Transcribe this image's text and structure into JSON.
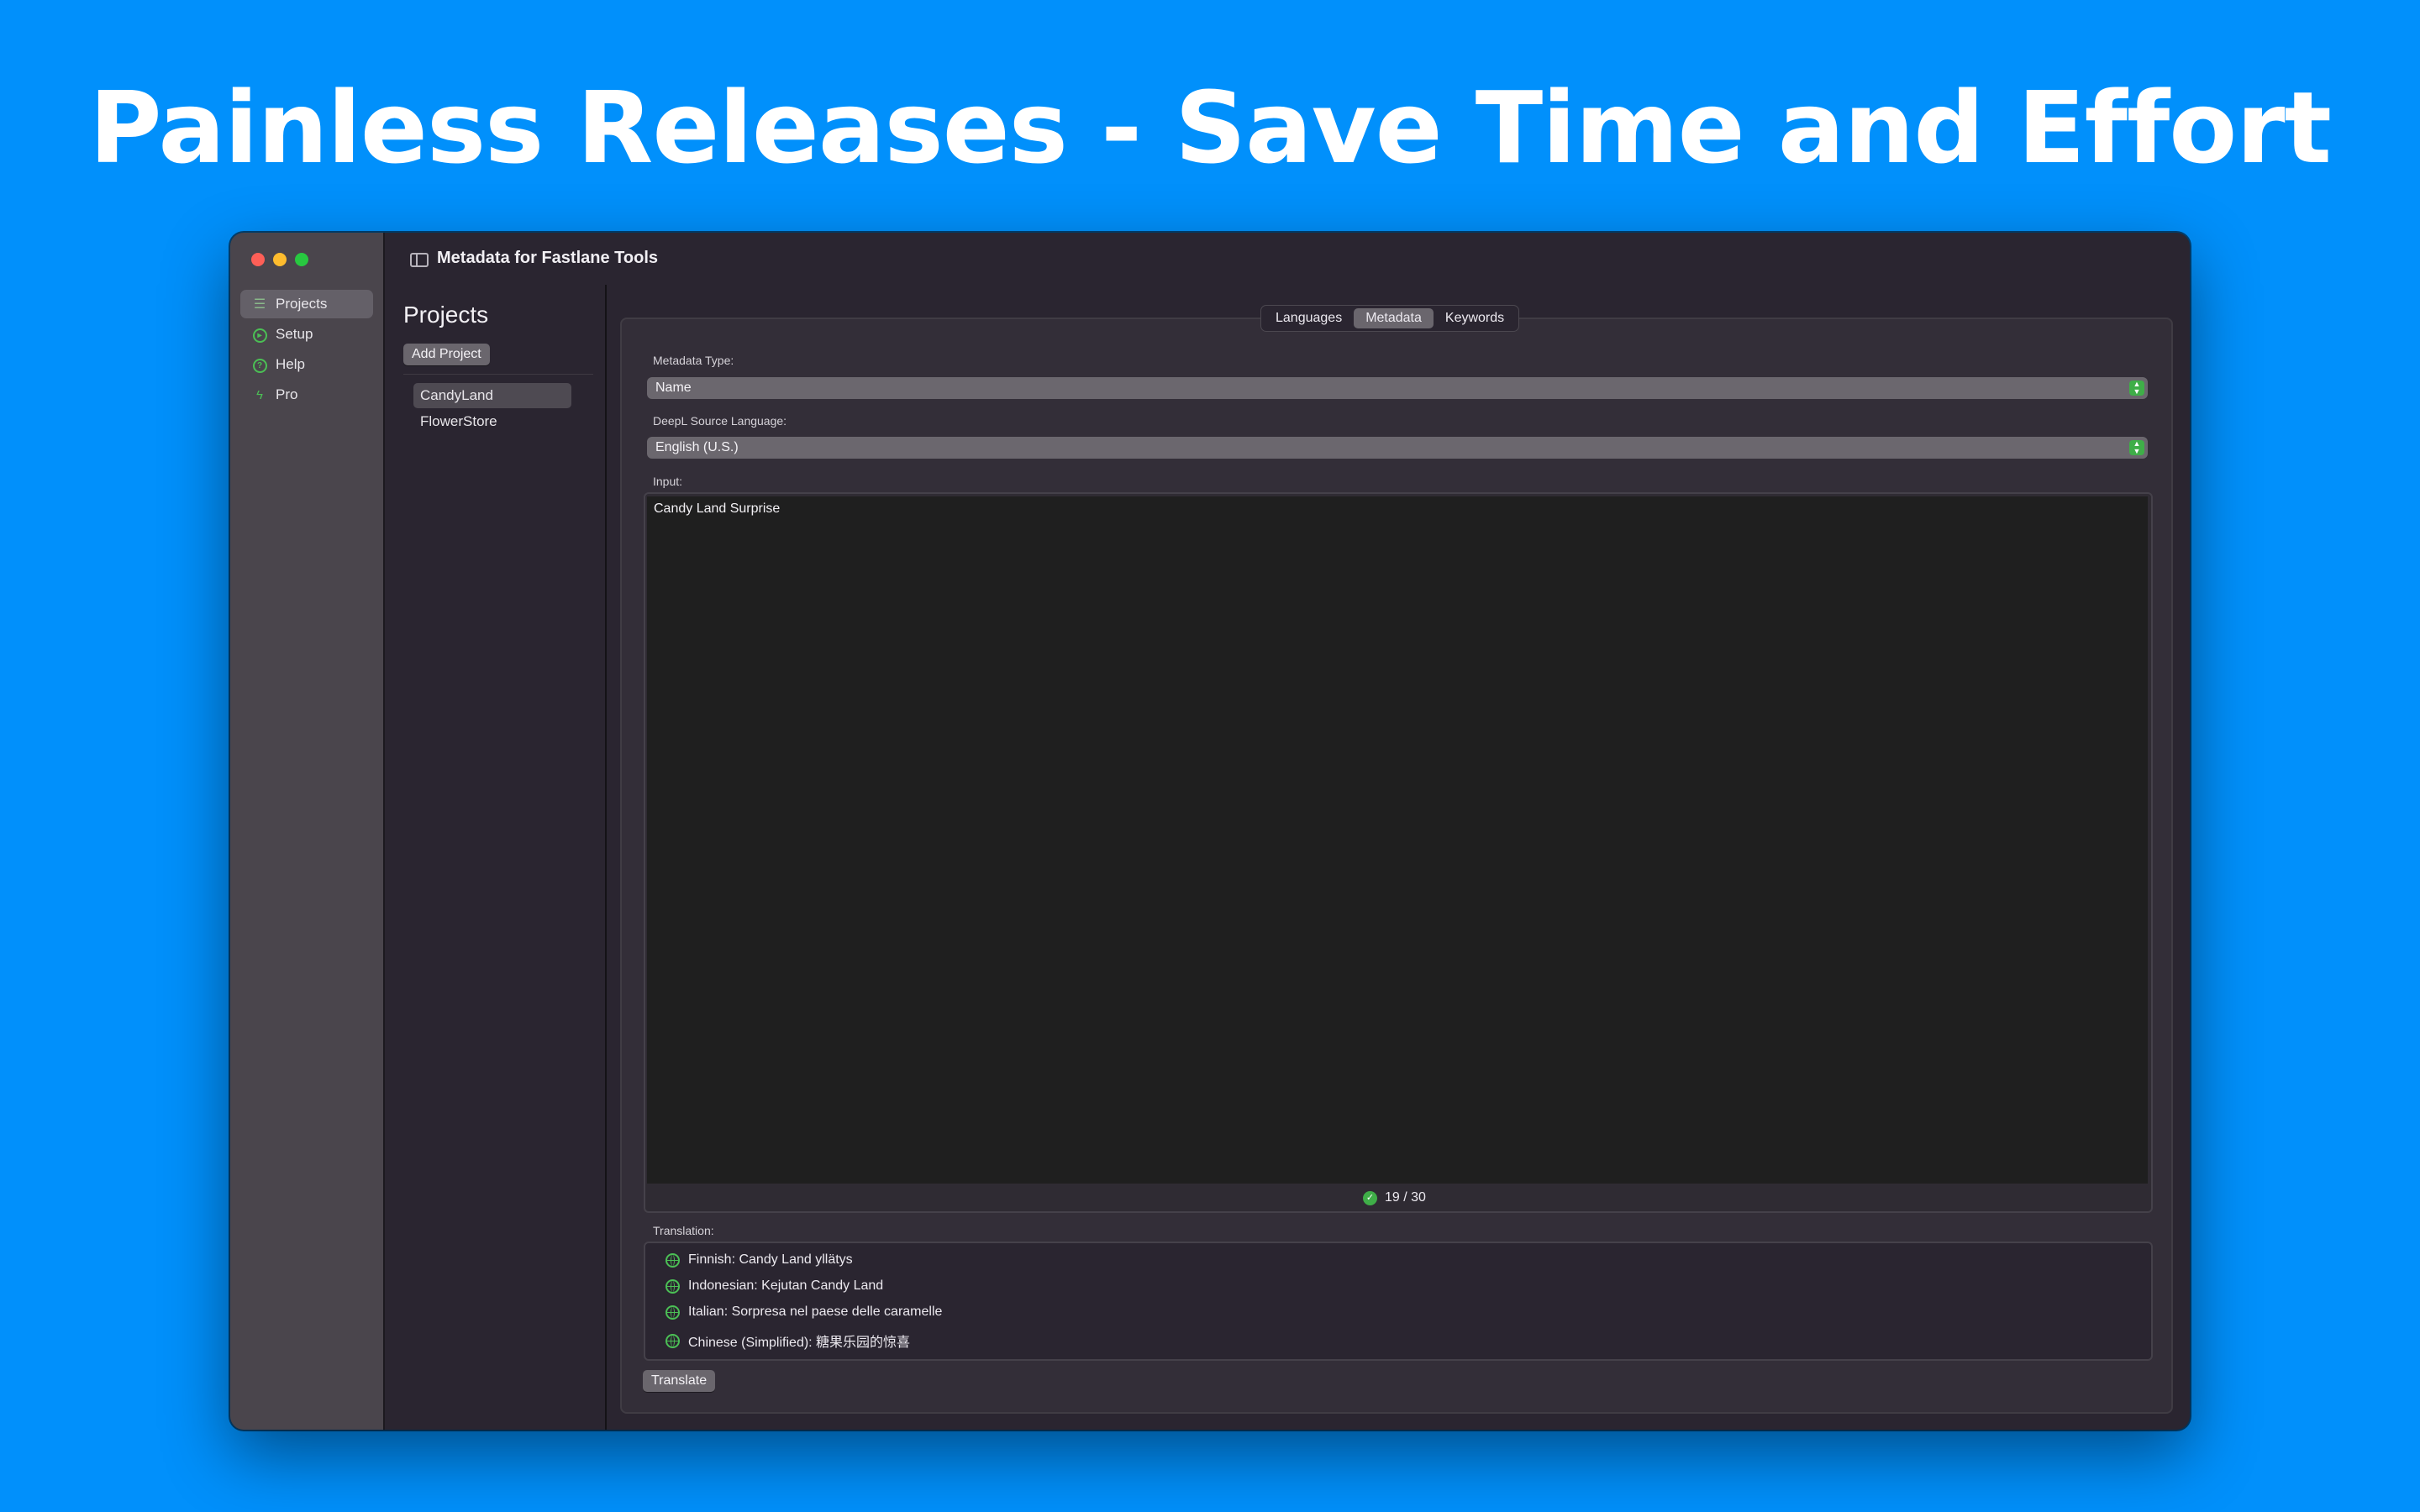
{
  "headline": "Painless Releases - Save Time and Effort",
  "window": {
    "title": "Metadata for Fastlane Tools"
  },
  "sidebar": {
    "items": [
      {
        "label": "Projects",
        "icon": "list-icon",
        "selected": true
      },
      {
        "label": "Setup",
        "icon": "play-circle-icon"
      },
      {
        "label": "Help",
        "icon": "question-circle-icon"
      },
      {
        "label": "Pro",
        "icon": "bolt-icon"
      }
    ]
  },
  "projects": {
    "heading": "Projects",
    "add_button": "Add Project",
    "items": [
      {
        "label": "CandyLand",
        "selected": true
      },
      {
        "label": "FlowerStore"
      }
    ]
  },
  "tabs": [
    {
      "label": "Languages"
    },
    {
      "label": "Metadata",
      "active": true
    },
    {
      "label": "Keywords"
    }
  ],
  "form": {
    "metadata_type_label": "Metadata Type:",
    "metadata_type_value": "Name",
    "source_language_label": "DeepL Source Language:",
    "source_language_value": "English (U.S.)",
    "input_label": "Input:",
    "input_value": "Candy Land Surprise",
    "char_count": "19 / 30",
    "translation_label": "Translation:",
    "translations": [
      "Finnish: Candy Land yllätys",
      "Indonesian: Kejutan Candy Land",
      "Italian: Sorpresa nel paese delle caramelle",
      "Chinese (Simplified): 糖果乐园的惊喜"
    ],
    "translate_button": "Translate"
  },
  "colors": {
    "background": "#0190fb",
    "accent_green": "#3fae48",
    "window_bg": "#2a2530",
    "sidebar_bg": "#4a454c"
  }
}
